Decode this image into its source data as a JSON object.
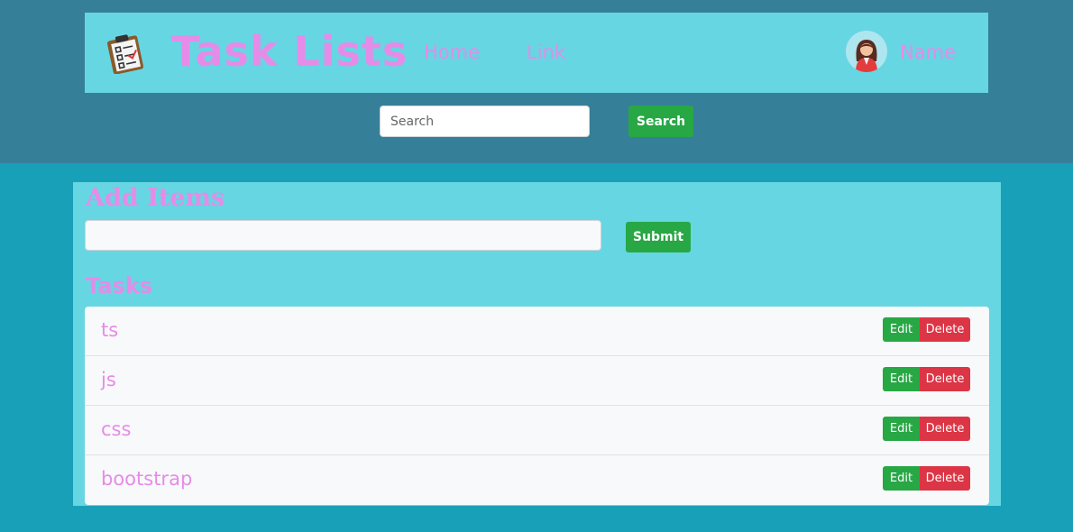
{
  "navbar": {
    "brand": "Task Lists",
    "logo_icon": "clipboard-checklist-icon",
    "links": [
      "Home",
      "Link"
    ],
    "user_name": "Name",
    "avatar_icon": "user-avatar-icon"
  },
  "search": {
    "placeholder": "Search",
    "button_label": "Search"
  },
  "add_items": {
    "title": "Add Items",
    "input_value": "",
    "submit_label": "Submit"
  },
  "tasks": {
    "title": "Tasks",
    "edit_label": "Edit",
    "delete_label": "Delete",
    "items": [
      "ts",
      "js",
      "css",
      "bootstrap"
    ]
  },
  "colors": {
    "header_bg": "#367f98",
    "page_bg": "#17a0b8",
    "panel_bg": "#66d6e2",
    "accent_text": "#e58ce8",
    "success": "#28a745",
    "danger": "#dc3545"
  }
}
